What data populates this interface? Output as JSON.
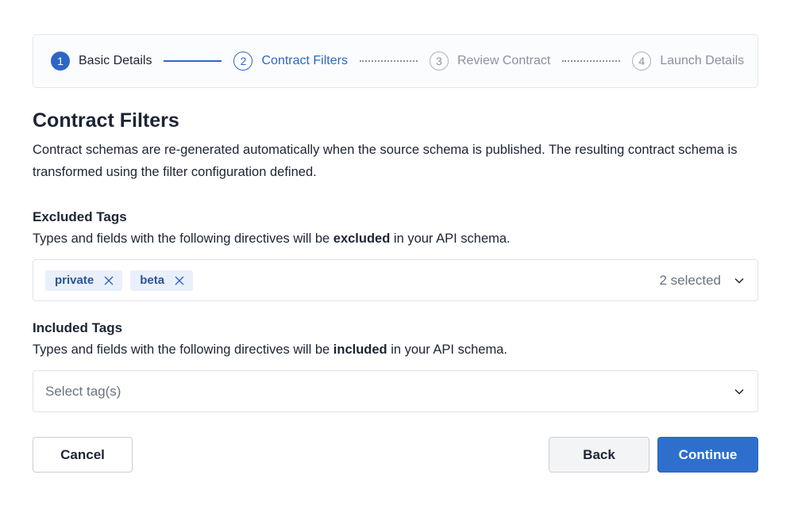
{
  "stepper": {
    "steps": [
      {
        "number": "1",
        "label": "Basic Details",
        "state": "complete"
      },
      {
        "number": "2",
        "label": "Contract Filters",
        "state": "active"
      },
      {
        "number": "3",
        "label": "Review Contract",
        "state": "pending"
      },
      {
        "number": "4",
        "label": "Launch Details",
        "state": "pending"
      }
    ]
  },
  "main": {
    "title": "Contract Filters",
    "description": "Contract schemas are re-generated automatically when the source schema is published. The resulting contract schema is transformed using the filter configuration defined."
  },
  "excluded": {
    "label": "Excluded Tags",
    "help_prefix": "Types and fields with the following directives will be ",
    "help_emphasis": "excluded",
    "help_suffix": " in your API schema.",
    "chips": [
      {
        "label": "private",
        "remove_icon": "close-icon"
      },
      {
        "label": "beta",
        "remove_icon": "close-icon"
      }
    ],
    "selected_count": "2 selected",
    "dropdown_icon": "chevron-down-icon"
  },
  "included": {
    "label": "Included Tags",
    "help_prefix": "Types and fields with the following directives will be ",
    "help_emphasis": "included",
    "help_suffix": " in your API schema.",
    "placeholder": "Select tag(s)",
    "dropdown_icon": "chevron-down-icon"
  },
  "actions": {
    "cancel_label": "Cancel",
    "back_label": "Back",
    "continue_label": "Continue"
  },
  "colors": {
    "accent": "#2e66c7",
    "chip_bg": "#e9f0fb",
    "chip_text": "#2a5596",
    "muted": "#8a919e"
  }
}
